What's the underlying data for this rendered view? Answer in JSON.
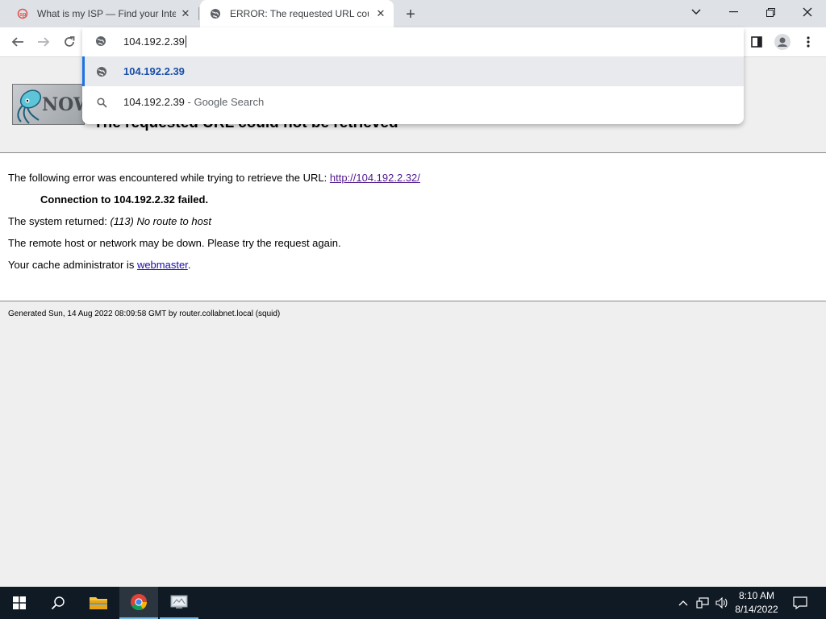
{
  "browser": {
    "tabs": [
      {
        "title": "What is my ISP — Find your Inte",
        "favicon": "isp-favicon-icon",
        "active": false
      },
      {
        "title": "ERROR: The requested URL could",
        "favicon": "globe-icon",
        "active": true
      }
    ],
    "omnibox": {
      "value": "104.192.2.39",
      "suggestions": [
        {
          "icon": "globe-icon",
          "text": "104.192.2.39",
          "sub": ""
        },
        {
          "icon": "search-icon",
          "text": "104.192.2.39",
          "sub": " - Google Search"
        }
      ]
    }
  },
  "page": {
    "logo_text": "NOW",
    "heading": "The requested URL could not be retrieved",
    "error_intro": "The following error was encountered while trying to retrieve the URL: ",
    "error_url": "http://104.192.2.32/",
    "connection_failed": "Connection to 104.192.2.32 failed.",
    "system_returned_label": "The system returned: ",
    "system_returned_value": "(113) No route to host",
    "remote_host_msg": "The remote host or network may be down. Please try the request again.",
    "cache_admin_label": "Your cache administrator is ",
    "cache_admin_link": "webmaster",
    "cache_admin_suffix": ".",
    "footer": "Generated Sun, 14 Aug 2022 08:09:58 GMT by router.collabnet.local (squid)"
  },
  "taskbar": {
    "time": "8:10 AM",
    "date": "8/14/2022"
  },
  "colors": {
    "tabstrip": "#dee1e6",
    "suggestion_highlight": "#e8eaed",
    "accent_blue": "#1a73e8",
    "taskbar": "#101a24"
  }
}
